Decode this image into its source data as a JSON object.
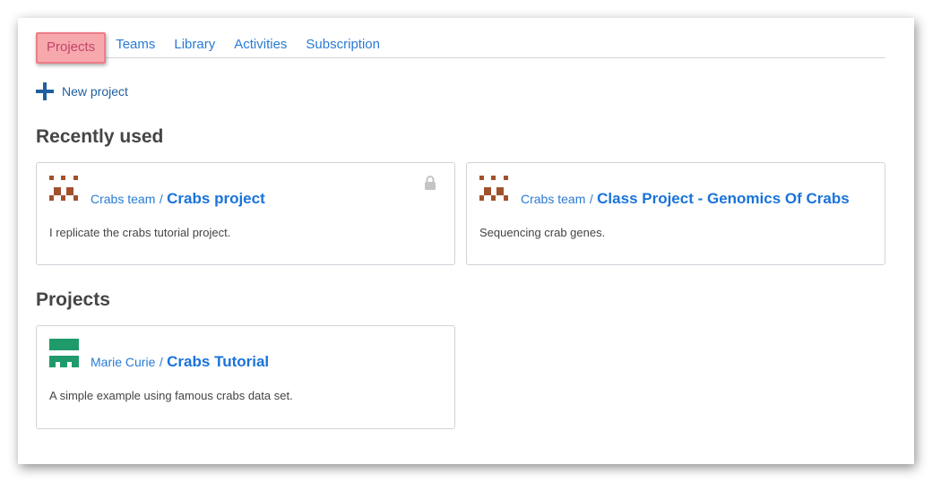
{
  "tabs": [
    {
      "label": "Projects",
      "active": true
    },
    {
      "label": "Teams"
    },
    {
      "label": "Library"
    },
    {
      "label": "Activities"
    },
    {
      "label": "Subscription"
    }
  ],
  "new_project": {
    "label": "New project",
    "icon": "plus-icon"
  },
  "recently_used": {
    "title": "Recently used",
    "cards": [
      {
        "owner": "Crabs team",
        "separator": "/",
        "name": "Crabs project",
        "description": "I replicate the crabs tutorial project.",
        "locked": true,
        "avatar_color": "#a0522d"
      },
      {
        "owner": "Crabs team",
        "separator": "/",
        "name": "Class Project - Genomics Of Crabs",
        "description": "Sequencing crab genes.",
        "locked": false,
        "avatar_color": "#a0522d"
      }
    ]
  },
  "projects": {
    "title": "Projects",
    "cards": [
      {
        "owner": "Marie Curie",
        "separator": "/",
        "name": "Crabs Tutorial",
        "description": "A simple example using famous crabs data set.",
        "locked": false,
        "avatar_color": "#1f9a6b"
      }
    ]
  },
  "colors": {
    "link": "#2a7bd3",
    "active_tab_bg": "#f7a8ad",
    "active_tab_text": "#c2456b"
  }
}
